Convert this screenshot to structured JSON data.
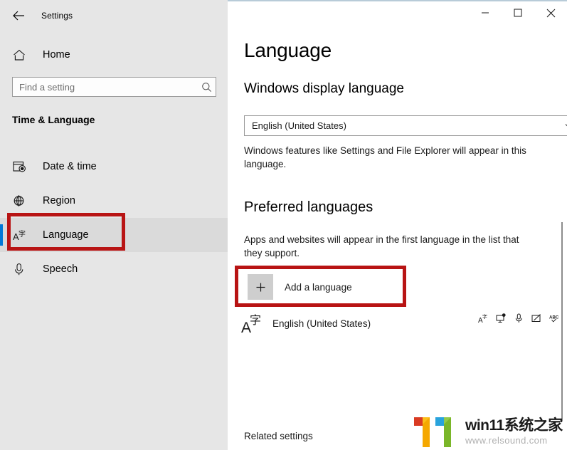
{
  "window": {
    "app_title": "Settings",
    "back_icon": "back-arrow-icon",
    "minimize_label": "—",
    "maximize_label": "□",
    "close_label": "✕"
  },
  "sidebar": {
    "home_label": "Home",
    "home_icon": "home-icon",
    "search": {
      "placeholder": "Find a setting",
      "value": "",
      "icon": "search-icon"
    },
    "category_title": "Time & Language",
    "items": [
      {
        "label": "Date & time",
        "icon": "calendar-clock-icon",
        "selected": false
      },
      {
        "label": "Region",
        "icon": "globe-icon",
        "selected": false
      },
      {
        "label": "Language",
        "icon": "language-icon",
        "selected": true
      },
      {
        "label": "Speech",
        "icon": "microphone-icon",
        "selected": false
      }
    ]
  },
  "main": {
    "page_title": "Language",
    "display_language": {
      "heading": "Windows display language",
      "selected_value": "English (United States)",
      "chevron_icon": "chevron-down-icon",
      "description": "Windows features like Settings and File Explorer will appear in this language."
    },
    "preferred_languages": {
      "heading": "Preferred languages",
      "description": "Apps and websites will appear in the first language in the list that they support.",
      "add_button": {
        "label": "Add a language",
        "icon": "plus-icon"
      },
      "list": [
        {
          "label": "English (United States)",
          "icon": "language-pack-icon",
          "feature_icons": [
            "language-pack-icon",
            "display-language-icon",
            "speech-microphone-icon",
            "handwriting-pen-icon",
            "spellcheck-abc-icon"
          ]
        }
      ]
    },
    "related_settings_label": "Related settings"
  },
  "annotations": [
    {
      "name": "highlight-language-nav",
      "color": "#b81414"
    },
    {
      "name": "highlight-add-language",
      "color": "#b81414"
    }
  ],
  "watermark": {
    "title": "win11系统之家",
    "url": "www.relsound.com",
    "colors": {
      "orange": "#f5a800",
      "green": "#7ab629",
      "red": "#d93b23",
      "blue": "#29a3dc"
    }
  },
  "theme": {
    "accent": "#0078d7",
    "sidebar_bg": "#e6e6e6",
    "annotation_red": "#b81414"
  }
}
